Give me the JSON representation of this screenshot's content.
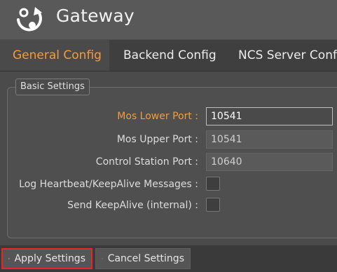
{
  "app": {
    "title": "Gateway",
    "logo_icon": "gateway-logo-icon"
  },
  "tabs": [
    {
      "label": "General Config",
      "active": true
    },
    {
      "label": "Backend Config",
      "active": false
    },
    {
      "label": "NCS Server Config",
      "active": false
    }
  ],
  "basic_settings": {
    "group_title": "Basic Settings",
    "mos_lower_port": {
      "label": "Mos Lower Port :",
      "value": "10541"
    },
    "mos_upper_port": {
      "label": "Mos Upper Port :",
      "value": "10541"
    },
    "control_station_port": {
      "label": "Control Station Port :",
      "value": "10640"
    },
    "log_heartbeat": {
      "label": "Log Heartbeat/KeepAlive Messages :",
      "checked": false
    },
    "send_keepalive": {
      "label": "Send KeepAlive (internal) :",
      "checked": false
    }
  },
  "footer": {
    "apply_label": "Apply Settings",
    "apply_icon": "save-icon",
    "cancel_label": "Cancel Settings",
    "cancel_icon": "close-icon"
  },
  "colors": {
    "accent": "#f39c3f",
    "highlight_border": "#e4262f"
  }
}
